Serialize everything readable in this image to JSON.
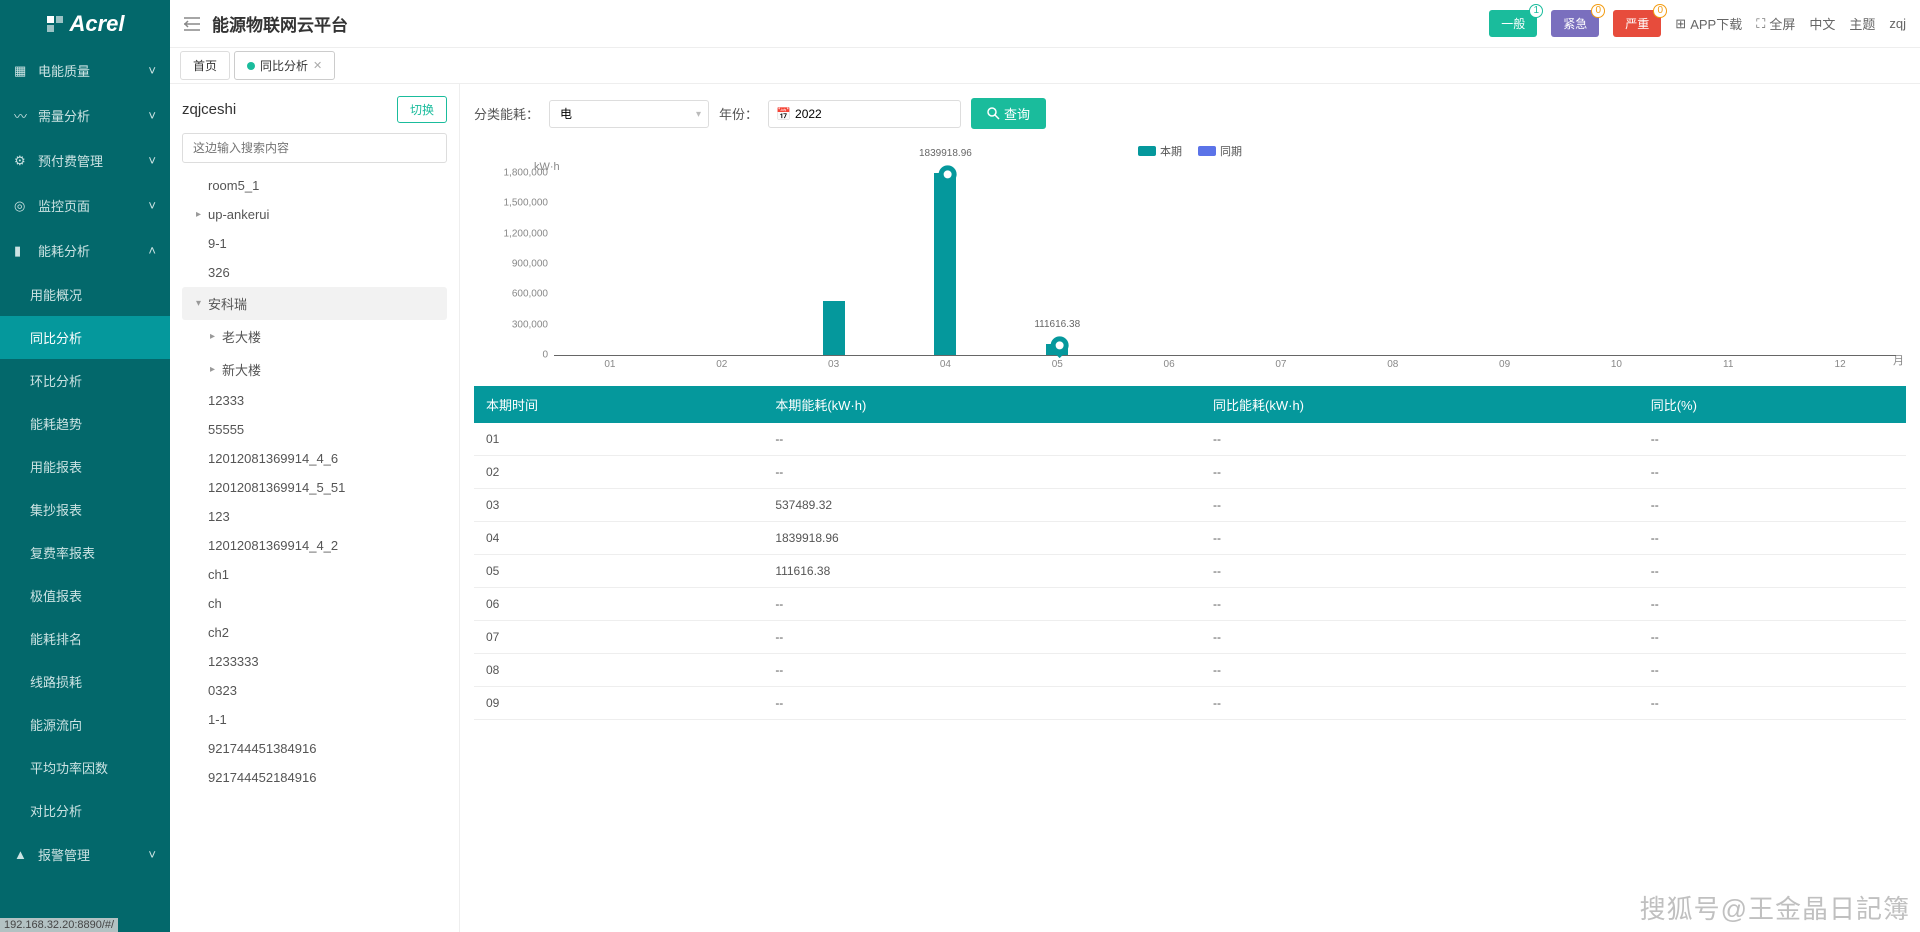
{
  "brand": "Acrel",
  "header": {
    "title": "能源物联网云平台",
    "badges": [
      {
        "label": "一般",
        "count": "1",
        "cls": "teal",
        "countCls": "c1"
      },
      {
        "label": "紧急",
        "count": "0",
        "cls": "purple",
        "countCls": "c2"
      },
      {
        "label": "严重",
        "count": "0",
        "cls": "red",
        "countCls": "c2"
      }
    ],
    "links": {
      "app": "APP下载",
      "fullscreen": "全屏",
      "lang": "中文",
      "theme": "主题",
      "user": "zqj"
    }
  },
  "sidebar": {
    "items": [
      {
        "label": "电能质量",
        "arrow": true
      },
      {
        "label": "需量分析",
        "arrow": true
      },
      {
        "label": "预付费管理",
        "arrow": true
      },
      {
        "label": "监控页面",
        "arrow": true
      },
      {
        "label": "能耗分析",
        "arrow": true,
        "expanded": true,
        "children": [
          {
            "label": "用能概况"
          },
          {
            "label": "同比分析",
            "active": true
          },
          {
            "label": "环比分析"
          },
          {
            "label": "能耗趋势"
          },
          {
            "label": "用能报表"
          },
          {
            "label": "集抄报表"
          },
          {
            "label": "复费率报表"
          },
          {
            "label": "极值报表"
          },
          {
            "label": "能耗排名"
          },
          {
            "label": "线路损耗"
          },
          {
            "label": "能源流向"
          },
          {
            "label": "平均功率因数"
          },
          {
            "label": "对比分析"
          }
        ]
      },
      {
        "label": "报警管理",
        "arrow": true
      }
    ]
  },
  "tabs": [
    {
      "label": "首页",
      "active": false,
      "closable": false
    },
    {
      "label": "同比分析",
      "active": true,
      "closable": true
    }
  ],
  "tree": {
    "title": "zqjceshi",
    "switch": "切换",
    "search_ph": "这边输入搜索内容",
    "nodes": [
      {
        "label": "room5_1",
        "level": 0
      },
      {
        "label": "up-ankerui",
        "level": 0,
        "caret": true
      },
      {
        "label": "9-1",
        "level": 0
      },
      {
        "label": "326",
        "level": 0
      },
      {
        "label": "安科瑞",
        "level": 0,
        "caret": true,
        "open": true,
        "selected": true
      },
      {
        "label": "老大楼",
        "level": 1,
        "caret": true
      },
      {
        "label": "新大楼",
        "level": 1,
        "caret": true
      },
      {
        "label": "12333",
        "level": 0
      },
      {
        "label": "55555",
        "level": 0
      },
      {
        "label": "12012081369914_4_6",
        "level": 0
      },
      {
        "label": "12012081369914_5_51",
        "level": 0
      },
      {
        "label": "123",
        "level": 0
      },
      {
        "label": "12012081369914_4_2",
        "level": 0
      },
      {
        "label": "ch1",
        "level": 0
      },
      {
        "label": "ch",
        "level": 0
      },
      {
        "label": "ch2",
        "level": 0
      },
      {
        "label": "1233333",
        "level": 0
      },
      {
        "label": "0323",
        "level": 0
      },
      {
        "label": "1-1",
        "level": 0
      },
      {
        "label": "921744451384916",
        "level": 0
      },
      {
        "label": "921744452184916",
        "level": 0
      }
    ]
  },
  "filters": {
    "type_label": "分类能耗：",
    "type_value": "电",
    "year_label": "年份：",
    "year_value": "2022",
    "query": "查询"
  },
  "chart_data": {
    "type": "bar",
    "y_unit": "kW·h",
    "x_unit": "月",
    "categories": [
      "01",
      "02",
      "03",
      "04",
      "05",
      "06",
      "07",
      "08",
      "09",
      "10",
      "11",
      "12"
    ],
    "legend": [
      {
        "name": "本期",
        "color": "#05989c"
      },
      {
        "name": "同期",
        "color": "#5b73e8"
      }
    ],
    "series": [
      {
        "name": "本期",
        "values": [
          null,
          null,
          537489.32,
          1839918.96,
          111616.38,
          null,
          null,
          null,
          null,
          null,
          null,
          null
        ]
      },
      {
        "name": "同期",
        "values": [
          null,
          null,
          null,
          null,
          null,
          null,
          null,
          null,
          null,
          null,
          null,
          null
        ]
      }
    ],
    "ylim": [
      0,
      1800000
    ],
    "yticks": [
      0,
      300000,
      600000,
      900000,
      1200000,
      1500000,
      1800000
    ],
    "ytick_labels": [
      "0",
      "300,000",
      "600,000",
      "900,000",
      "1,200,000",
      "1,500,000",
      "1,800,000"
    ],
    "highlighted_labels": {
      "3": "1839918.96",
      "4": "111616.38"
    }
  },
  "table": {
    "headers": [
      "本期时间",
      "本期能耗(kW·h)",
      "同比能耗(kW·h)",
      "同比(%)"
    ],
    "rows": [
      [
        "01",
        "--",
        "--",
        "--"
      ],
      [
        "02",
        "--",
        "--",
        "--"
      ],
      [
        "03",
        "537489.32",
        "--",
        "--"
      ],
      [
        "04",
        "1839918.96",
        "--",
        "--"
      ],
      [
        "05",
        "111616.38",
        "--",
        "--"
      ],
      [
        "06",
        "--",
        "--",
        "--"
      ],
      [
        "07",
        "--",
        "--",
        "--"
      ],
      [
        "08",
        "--",
        "--",
        "--"
      ],
      [
        "09",
        "--",
        "--",
        "--"
      ]
    ]
  },
  "status_bar": "192.168.32.20:8890/#/",
  "watermark": "搜狐号@王金晶日記簿"
}
